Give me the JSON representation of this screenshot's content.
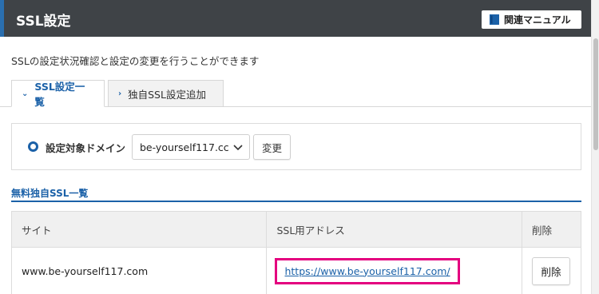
{
  "header": {
    "title": "SSL設定",
    "manual_label": "関連マニュアル",
    "manual_icon": "book-icon",
    "colors": {
      "bar": "#3f4347",
      "accent": "#2a6fb0"
    }
  },
  "description": "SSLの設定状況確認と設定の変更を行うことができます",
  "tabs": [
    {
      "label": "SSL設定一覧",
      "icon": "chevron-down-icon",
      "active": true
    },
    {
      "label": "独自SSL設定追加",
      "icon": "chevron-right-icon",
      "active": false
    }
  ],
  "domain_selector": {
    "label": "設定対象ドメイン",
    "selected_value": "be-yourself117.cc",
    "change_label": "変更"
  },
  "ssl_section": {
    "title": "無料独自SSL一覧",
    "columns": [
      "サイト",
      "SSL用アドレス",
      "削除"
    ],
    "rows": [
      {
        "site": "www.be-yourself117.com",
        "ssl_address": "https://www.be-yourself117.com/",
        "delete_label": "削除"
      }
    ]
  },
  "accent_colors": {
    "link": "#1b61a8",
    "highlight": "#e4007f"
  }
}
